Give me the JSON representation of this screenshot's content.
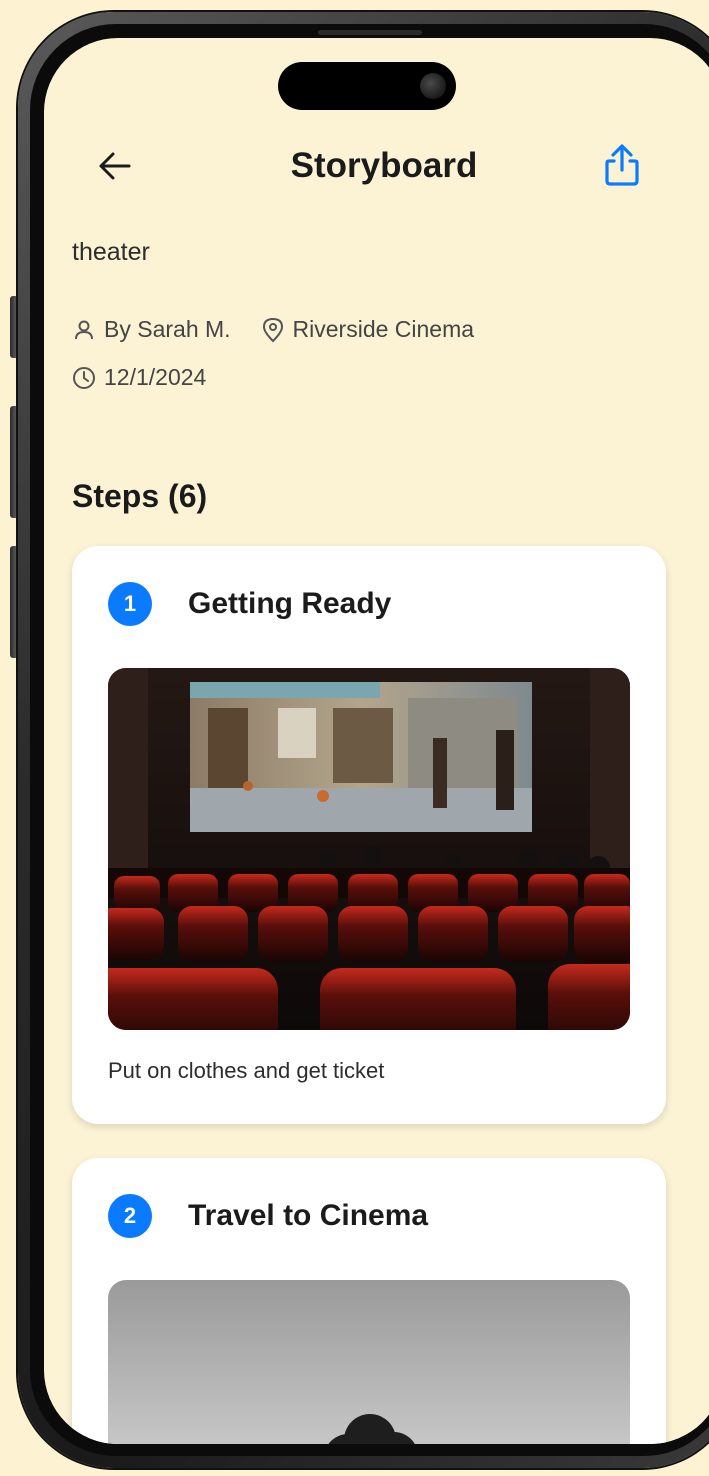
{
  "header": {
    "title": "Storyboard",
    "back_icon": "arrow-left-icon",
    "share_icon": "share-upload-icon"
  },
  "story": {
    "subtitle": "theater",
    "author": "By Sarah M.",
    "location": "Riverside Cinema",
    "date": "12/1/2024"
  },
  "steps_section": {
    "title": "Steps (6)"
  },
  "steps": [
    {
      "number": "1",
      "title": "Getting Ready",
      "image": "movie-theater-photo",
      "description": "Put on clothes and get ticket"
    },
    {
      "number": "2",
      "title": "Travel to Cinema",
      "image": "grayscale-tree-photo"
    }
  ],
  "colors": {
    "background": "#FCF3D5",
    "accent": "#0A7BFF",
    "card": "#FFFFFF",
    "text": "#1B1B1B"
  }
}
